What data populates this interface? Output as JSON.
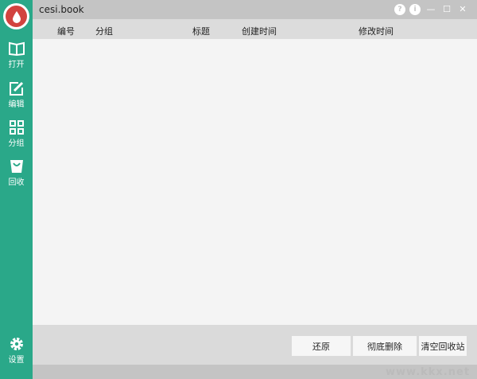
{
  "window": {
    "title": "cesi.book",
    "help": "?",
    "info": "i",
    "minimize": "—",
    "maximize": "☐",
    "close": "✕"
  },
  "sidebar": {
    "items": [
      {
        "label": "打开",
        "icon": "book-open-icon"
      },
      {
        "label": "编辑",
        "icon": "edit-icon"
      },
      {
        "label": "分组",
        "icon": "grid-icon"
      },
      {
        "label": "回收",
        "icon": "recycle-bag-icon"
      },
      {
        "label": "设置",
        "icon": "gear-icon"
      }
    ]
  },
  "table": {
    "columns": [
      "编号",
      "分组",
      "标题",
      "创建时间",
      "修改时间"
    ],
    "rows": []
  },
  "footer": {
    "restore": "还原",
    "delete_forever": "彻底删除",
    "empty_bin": "清空回收站"
  },
  "watermark": "www.kkx.net",
  "colors": {
    "sidebar": "#2aa889",
    "logo": "#d2433f"
  }
}
